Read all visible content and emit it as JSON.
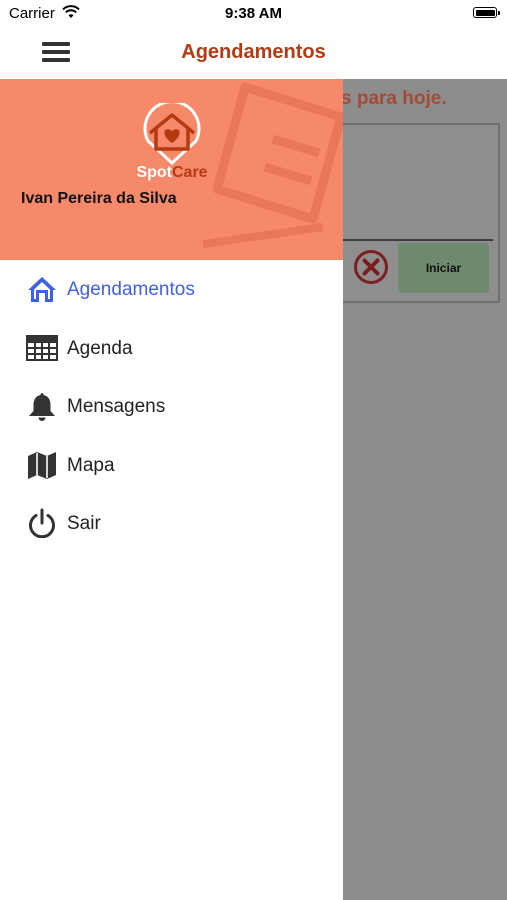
{
  "status_bar": {
    "carrier": "Carrier",
    "time": "9:38 AM"
  },
  "header": {
    "title": "Agendamentos"
  },
  "background": {
    "notice": "s para hoje.",
    "start_label": "Iniciar"
  },
  "drawer": {
    "brand_spot": "Spot",
    "brand_care": "Care",
    "user_name": "Ivan Pereira da Silva",
    "items": [
      {
        "label": "Agendamentos",
        "icon": "home-icon",
        "active": true
      },
      {
        "label": "Agenda",
        "icon": "calendar-grid-icon",
        "active": false
      },
      {
        "label": "Mensagens",
        "icon": "bell-icon",
        "active": false
      },
      {
        "label": "Mapa",
        "icon": "map-icon",
        "active": false
      },
      {
        "label": "Sair",
        "icon": "power-icon",
        "active": false
      }
    ]
  },
  "colors": {
    "accent": "#b53a12",
    "drawer_header": "#f5896a",
    "active_item": "#3f5fe6",
    "overlay": "#8d8d8d"
  }
}
